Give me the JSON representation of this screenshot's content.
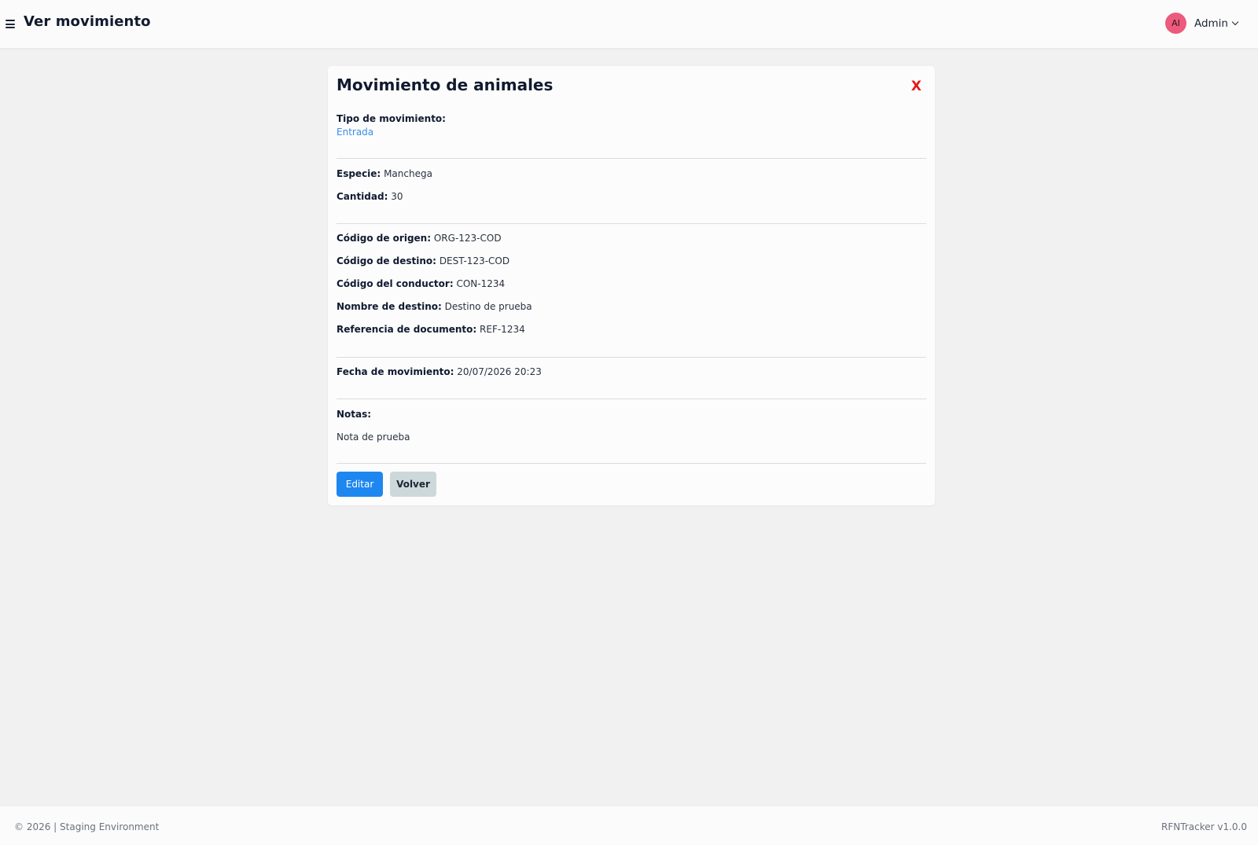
{
  "header": {
    "title": "Ver movimiento",
    "user": {
      "initials": "AI",
      "name": "Admin"
    }
  },
  "card": {
    "title": "Movimiento de animales",
    "close_label": "X",
    "tipo": {
      "label": "Tipo de movimiento:",
      "value": "Entrada"
    },
    "especie": {
      "label": "Especie:",
      "value": "Manchega"
    },
    "cantidad": {
      "label": "Cantidad:",
      "value": "30"
    },
    "origen": {
      "label": "Código de origen:",
      "value": "ORG-123-COD"
    },
    "destino": {
      "label": "Código de destino:",
      "value": "DEST-123-COD"
    },
    "conductor": {
      "label": "Código del conductor:",
      "value": "CON-1234"
    },
    "nombre_destino": {
      "label": "Nombre de destino:",
      "value": "Destino de prueba"
    },
    "referencia": {
      "label": "Referencia de documento:",
      "value": "REF-1234"
    },
    "fecha": {
      "label": "Fecha de movimiento:",
      "value": "20/07/2026 20:23"
    },
    "notas": {
      "label": "Notas:",
      "value": "Nota de prueba"
    },
    "buttons": {
      "edit": "Editar",
      "back": "Volver"
    }
  },
  "footer": {
    "left": "© 2026 | Staging Environment",
    "right": "RFNTracker v1.0.0"
  },
  "colors": {
    "accent": "#1e87ef",
    "avatar": "#ec5b7c",
    "close": "#e01b1b",
    "link": "#3a8ee6"
  }
}
